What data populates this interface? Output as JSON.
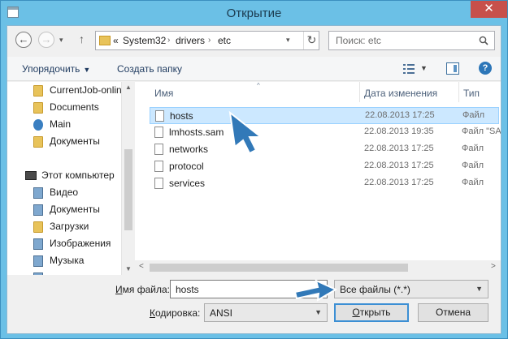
{
  "window": {
    "title": "Открытие",
    "close_glyph": "✕"
  },
  "nav": {
    "back_glyph": "←",
    "forward_glyph": "→",
    "up_glyph": "↑",
    "recent_glyph": "▾"
  },
  "address": {
    "overflow_glyph": "«",
    "segments": [
      "System32",
      "drivers",
      "etc"
    ],
    "separator_glyph": "›",
    "dropdown_glyph": "▾",
    "refresh_glyph": "↻"
  },
  "search": {
    "placeholder": "Поиск: etc",
    "icon": "search-icon"
  },
  "commandbar": {
    "organize": "Упорядочить",
    "organize_arrow": "▼",
    "new_folder": "Создать папку",
    "view_dropdown_glyph": "▼",
    "help_glyph": "?"
  },
  "sidebar": {
    "items": [
      {
        "label": "CurrentJob-onlin",
        "icon": "folder-icon"
      },
      {
        "label": "Documents",
        "icon": "folder-icon"
      },
      {
        "label": "Main",
        "icon": "sync-folder-icon"
      },
      {
        "label": "Документы",
        "icon": "folder-icon"
      },
      {
        "label": "Этот компьютер",
        "icon": "computer-icon"
      },
      {
        "label": "Видео",
        "icon": "library-icon"
      },
      {
        "label": "Документы",
        "icon": "library-icon"
      },
      {
        "label": "Загрузки",
        "icon": "folder-icon"
      },
      {
        "label": "Изображения",
        "icon": "library-icon"
      },
      {
        "label": "Музыка",
        "icon": "library-icon"
      },
      {
        "label": "",
        "icon": "library-icon"
      }
    ],
    "scroll_up_glyph": "▲",
    "scroll_down_glyph": "▼"
  },
  "filelist": {
    "columns": [
      "Имя",
      "Дата изменения",
      "Тип"
    ],
    "sort_glyph": "^",
    "rows": [
      {
        "name": "hosts",
        "date": "22.08.2013 17:25",
        "type": "Файл",
        "selected": true
      },
      {
        "name": "lmhosts.sam",
        "date": "22.08.2013 19:35",
        "type": "Файл \"SA",
        "selected": false
      },
      {
        "name": "networks",
        "date": "22.08.2013 17:25",
        "type": "Файл",
        "selected": false
      },
      {
        "name": "protocol",
        "date": "22.08.2013 17:25",
        "type": "Файл",
        "selected": false
      },
      {
        "name": "services",
        "date": "22.08.2013 17:25",
        "type": "Файл",
        "selected": false
      }
    ],
    "scroll_left_glyph": "<",
    "scroll_right_glyph": ">"
  },
  "bottom": {
    "filename_label_ul": "И",
    "filename_label_rest": "мя файла:",
    "filename_value": "hosts",
    "filetype_value": "Все файлы  (*.*)",
    "dropdown_glyph": "▼",
    "encoding_label_ul": "К",
    "encoding_label_rest": "одировка:",
    "encoding_value": "ANSI",
    "open_button_ul": "О",
    "open_button_rest": "ткрыть",
    "cancel_button": "Отмена"
  },
  "colors": {
    "window_frame": "#6bc0e6",
    "close_button": "#c7504b",
    "selection": "#cce8ff",
    "pointer_arrow": "#3279b8"
  }
}
